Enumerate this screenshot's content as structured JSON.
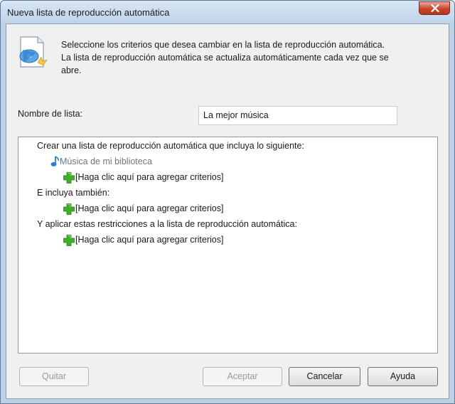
{
  "window": {
    "title": "Nueva lista de reproducción automática"
  },
  "header": {
    "instructions_line1": "Seleccione los criterios que desea cambiar en la lista de reproducción automática.",
    "instructions_line2": "La lista de reproducción automática se actualiza automáticamente cada vez que se",
    "instructions_line3": "abre."
  },
  "form": {
    "name_label": "Nombre de lista:",
    "name_value": "La mejor música"
  },
  "criteria": {
    "section1": "Crear una lista de reproducción automática que incluya lo siguiente:",
    "library_item": "Música de mi biblioteca",
    "add_criteria_1": "[Haga clic aquí para agregar criterios]",
    "section2": "E incluya también:",
    "add_criteria_2": "[Haga clic aquí para agregar criterios]",
    "section3": "Y aplicar estas restricciones a la lista de reproducción automática:",
    "add_criteria_3": "[Haga clic aquí para agregar criterios]"
  },
  "buttons": {
    "remove": "Quitar",
    "accept": "Aceptar",
    "cancel": "Cancelar",
    "help": "Ayuda"
  },
  "icons": {
    "header": "playlist-disc-icon",
    "music_note": "music-note-icon",
    "add": "green-plus-icon",
    "close": "close-icon"
  },
  "colors": {
    "add_icon": "#3fae2a",
    "music_note": "#2d7fd3",
    "close_button": "#c8452b"
  }
}
